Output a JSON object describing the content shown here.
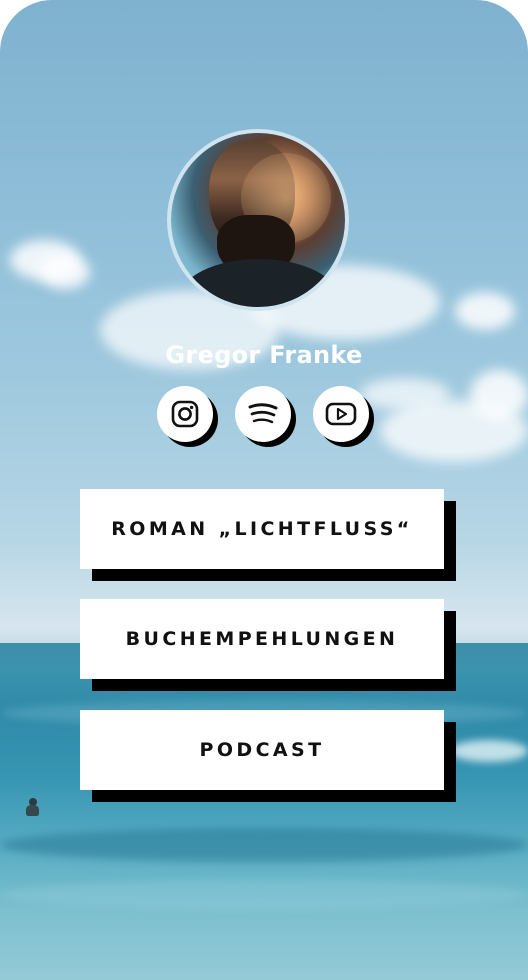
{
  "profile": {
    "name": "Gregor Franke"
  },
  "socials": [
    {
      "name": "instagram",
      "icon": "instagram-icon"
    },
    {
      "name": "spotify",
      "icon": "spotify-icon"
    },
    {
      "name": "youtube",
      "icon": "youtube-icon"
    }
  ],
  "links": [
    {
      "label": "ROMAN „LICHTFLUSS“"
    },
    {
      "label": "BUCHEMPEHLUNGEN"
    },
    {
      "label": "PODCAST"
    }
  ],
  "colors": {
    "button_bg": "#ffffff",
    "button_shadow": "#000000",
    "text": "#111111",
    "name_text": "#ffffff",
    "sky": "#8cbcd7",
    "sea": "#2f8aa8"
  }
}
